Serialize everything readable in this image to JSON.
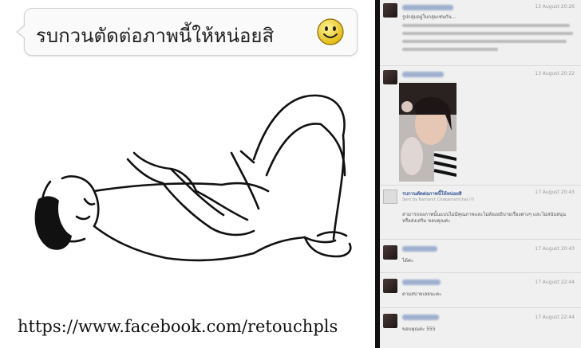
{
  "left_panel": {
    "caption": "รบกวนตัดต่อภาพนี้ให้หน่อยสิ",
    "emoticon": "smiley-face-icon",
    "url": "https://www.facebook.com/retouchpls"
  },
  "right_panel": {
    "posts": [
      {
        "date": "13 August 20:26",
        "text": "รูปกลุ่มอยู่ในกลุ่มเช่นกัน...",
        "attachment": false
      },
      {
        "date": "13 August 20:22",
        "text": "",
        "attachment": true
      },
      {
        "date": "17 August 20:43",
        "page_name": "รบกวนตัดต่อภาพนี้ให้หน่อยสิ",
        "sent_by": "Sent by Kamonrt Chakarnsirichai (?)",
        "text": "สามารถลงภาพนั้นแบบไม่มีคุณภาพและไม่ต้องอธิบายเรื่องต่างๆ และไม่สนับสนุนหรือส่งเสริม ขอบคุณค่ะ",
        "attachment": false
      },
      {
        "date": "17 August 20:43",
        "text": "ได้ค่ะ",
        "attachment": false
      },
      {
        "date": "17 August 22:44",
        "text": "ตามสบายเลยนะคะ",
        "attachment": false
      },
      {
        "date": "17 August 22:44",
        "text": "ขอบคุณค่ะ 555",
        "attachment": false
      }
    ]
  },
  "colors": {
    "divider": "#111111",
    "link_blue": "#3b5998",
    "chat_bg": "#f0f0f0"
  }
}
